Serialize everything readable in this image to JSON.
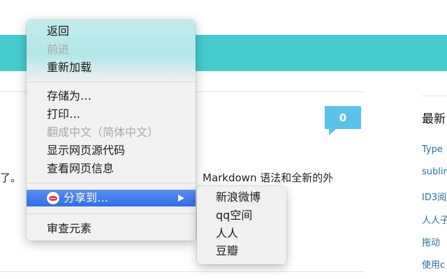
{
  "page": {
    "comment_count": "0",
    "body_text_left": "了。",
    "body_text_right": "Markdown 语法和全新的外",
    "sidebar": {
      "heading": "最新",
      "links": [
        "Type",
        "sublin",
        "ID3阅",
        "人人子",
        "拖动",
        "使用c"
      ]
    }
  },
  "context_menu": {
    "items": [
      {
        "label": "返回",
        "enabled": true
      },
      {
        "label": "前进",
        "enabled": false
      },
      {
        "label": "重新加载",
        "enabled": true
      },
      {
        "label": "存储为…",
        "enabled": true
      },
      {
        "label": "打印…",
        "enabled": true
      },
      {
        "label": "翻成中文（简体中文）",
        "enabled": false
      },
      {
        "label": "显示网页源代码",
        "enabled": true
      },
      {
        "label": "查看网页信息",
        "enabled": true
      },
      {
        "label": "分享到…",
        "enabled": true,
        "highlighted": true,
        "icon": "lips-share-icon",
        "has_submenu": true
      },
      {
        "label": "审查元素",
        "enabled": true
      }
    ],
    "highlight_color": "#2f6ee8"
  },
  "share_submenu": {
    "items": [
      "新浪微博",
      "qq空间",
      "人人",
      "豆瓣"
    ]
  },
  "colors": {
    "header_band": "#46cccd",
    "badge": "#5bc3eb",
    "link": "#2173b0"
  }
}
